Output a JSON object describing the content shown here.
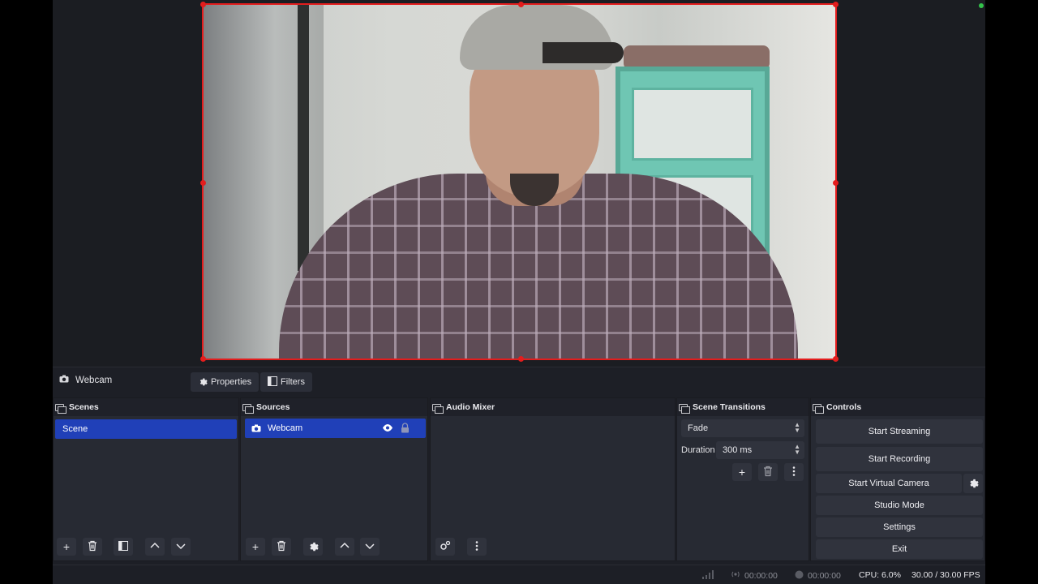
{
  "context_bar": {
    "source_name": "Webcam",
    "properties_label": "Properties",
    "filters_label": "Filters"
  },
  "docks": {
    "scenes": {
      "title": "Scenes",
      "items": [
        "Scene"
      ]
    },
    "sources": {
      "title": "Sources",
      "items": [
        {
          "name": "Webcam",
          "icon": "camera-icon"
        }
      ]
    },
    "audio_mixer": {
      "title": "Audio Mixer"
    },
    "scene_transitions": {
      "title": "Scene Transitions",
      "transition": "Fade",
      "duration_label": "Duration",
      "duration_value": "300 ms"
    },
    "controls": {
      "title": "Controls",
      "start_streaming": "Start Streaming",
      "start_recording": "Start Recording",
      "start_virtual_camera": "Start Virtual Camera",
      "studio_mode": "Studio Mode",
      "settings": "Settings",
      "exit": "Exit"
    }
  },
  "statusbar": {
    "stream_time": "00:00:00",
    "record_time": "00:00:00",
    "cpu": "CPU: 6.0%",
    "fps": "30.00 / 30.00 FPS"
  },
  "colors": {
    "selection": "#e31d1d",
    "selected_item": "#2040b8",
    "dock_bg": "#272a33",
    "status_dot": "#33c24a"
  }
}
